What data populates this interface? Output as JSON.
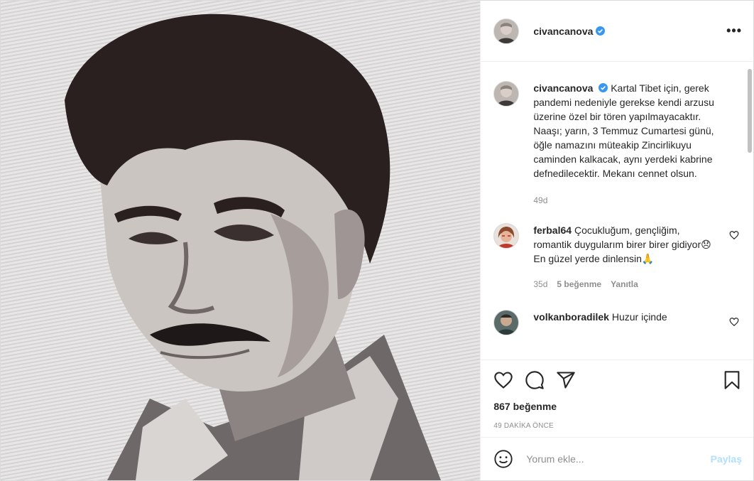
{
  "author": {
    "username": "civancanova"
  },
  "caption": {
    "username": "civancanova",
    "text": "Kartal Tibet için, gerek pandemi nedeniyle gerekse kendi arzusu üzerine özel bir tören yapılmayacaktır. Naaşı; yarın, 3 Temmuz Cumartesi günü, öğle namazını müteakip Zincirlikuyu caminden kalkacak, aynı yerdeki kabrine defnedilecektir. Mekanı cennet olsun.",
    "age": "49d"
  },
  "comments": [
    {
      "username": "ferbal64",
      "text": "Çocukluğum, gençliğim, romantik duygularım birer birer gidiyor😞En güzel yerde dinlensin🙏",
      "age": "35d",
      "likes": "5 beğenme",
      "reply": "Yanıtla"
    },
    {
      "username": "volkanboradilek",
      "text": "Huzur içinde"
    }
  ],
  "likes_count": "867 beğenme",
  "posted_time": "49 DAKİKA ÖNCE",
  "add_comment": {
    "placeholder": "Yorum ekle...",
    "post_label": "Paylaş"
  },
  "colors": {
    "verified": "#3897f0",
    "post_disabled": "#b2dffc",
    "muted": "#8e8e8e"
  }
}
